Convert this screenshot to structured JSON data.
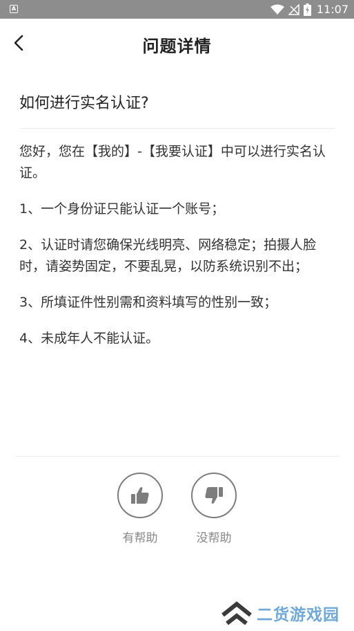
{
  "status_bar": {
    "app_icon_letter": "A",
    "time": "11:07"
  },
  "header": {
    "title": "问题详情"
  },
  "question": {
    "title": "如何进行实名认证?"
  },
  "answer": {
    "paragraphs": [
      "您好，您在【我的】-【我要认证】中可以进行实名认证。",
      "1、一个身份证只能认证一个账号；",
      "2、认证时请您确保光线明亮、网络稳定；拍摄人脸时，请姿势固定，不要乱晃，以防系统识别不出；",
      "3、所填证件性别需和资料填写的性别一致；",
      "4、未成年人不能认证。"
    ]
  },
  "feedback": {
    "helpful_label": "有帮助",
    "unhelpful_label": "没帮助"
  },
  "watermark": {
    "text": "二货游戏园"
  },
  "colors": {
    "status_bar": "#8d8d8d",
    "icon_gray": "#7d7d7d",
    "label_gray": "#888888",
    "watermark_blue": "#6fa9d9",
    "watermark_dark": "#3a3a3a"
  }
}
